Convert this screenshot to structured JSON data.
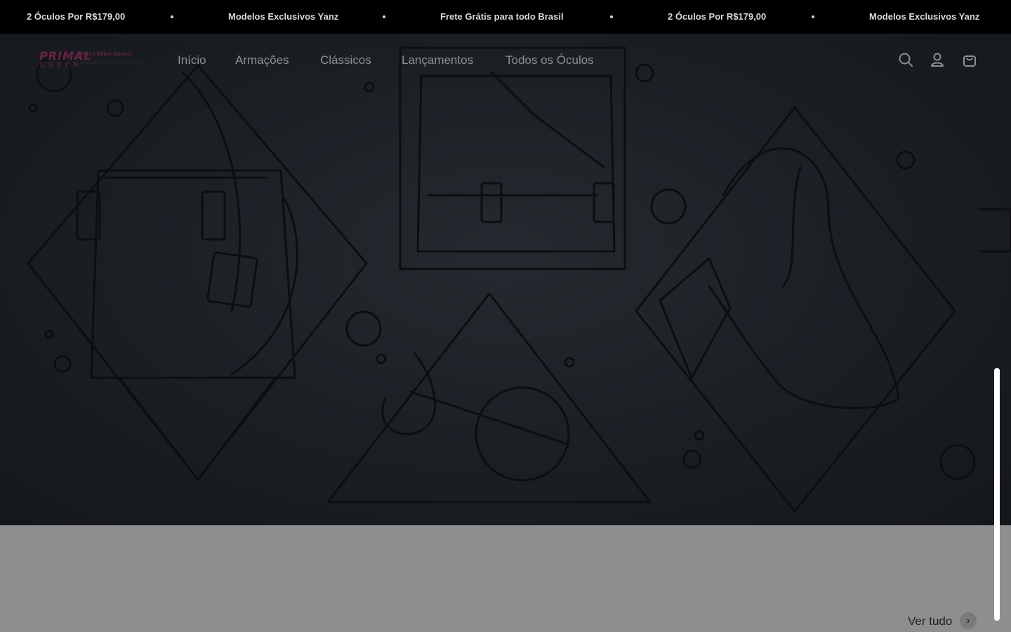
{
  "announcement": {
    "items": [
      "2 Óculos Por R$179,00",
      "Modelos Exclusivos Yanz",
      "Frete Grátis para todo Brasil",
      "2 Óculos Por R$179,00",
      "Modelos Exclusivos Yanz"
    ]
  },
  "logo": {
    "word_top": "PRIMAL",
    "word_bottom": "QUEEN",
    "tagline": "Over 1 Million Queens",
    "subtagline": "Ships Within 1 Business Day"
  },
  "nav": {
    "items": [
      "Início",
      "Armações",
      "Clássicos",
      "Lançamentos",
      "Todos os Óculos"
    ]
  },
  "header_icons": {
    "search": "search-icon",
    "account": "account-icon",
    "cart": "cart-icon"
  },
  "collection": {
    "view_all_label": "Ver tudo",
    "view_all_icon": "chevron-right-icon"
  },
  "colors": {
    "announcement_bg": "#000000",
    "hero_bg": "#1b1f24",
    "brand": "#6a2347",
    "page_bg": "#8e8e8e"
  }
}
